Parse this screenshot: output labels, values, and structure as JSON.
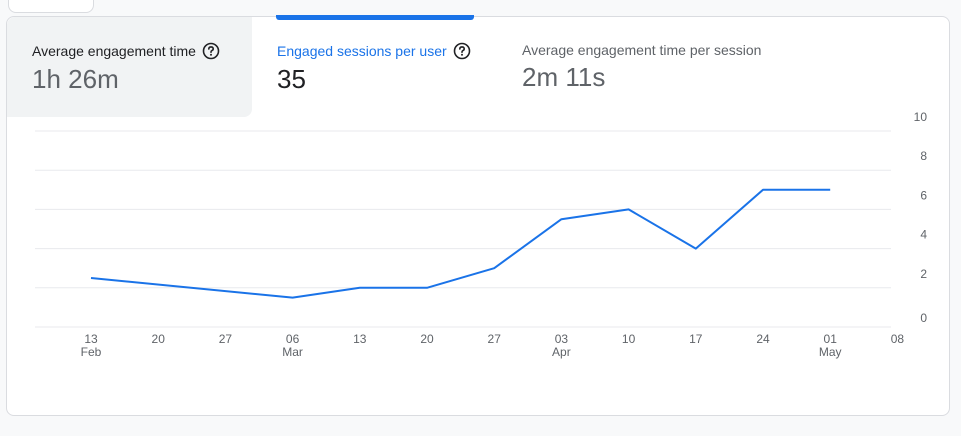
{
  "metrics": [
    {
      "label": "Average engagement time",
      "value": "1h 26m",
      "has_help": true
    },
    {
      "label": "Engaged sessions per user",
      "value": "35",
      "has_help": true,
      "selected": true
    },
    {
      "label": "Average engagement time per session",
      "value": "2m 11s",
      "has_help": false
    }
  ],
  "colors": {
    "accent": "#1a73e8",
    "line": "#1a73e8",
    "grid": "#e8eaed",
    "text": "#202124",
    "muted": "#5f6368"
  },
  "chart_data": {
    "type": "line",
    "x_ticks": [
      {
        "label": "13",
        "sub": "Feb"
      },
      {
        "label": "20",
        "sub": ""
      },
      {
        "label": "27",
        "sub": ""
      },
      {
        "label": "06",
        "sub": "Mar"
      },
      {
        "label": "13",
        "sub": ""
      },
      {
        "label": "20",
        "sub": ""
      },
      {
        "label": "27",
        "sub": ""
      },
      {
        "label": "03",
        "sub": "Apr"
      },
      {
        "label": "10",
        "sub": ""
      },
      {
        "label": "17",
        "sub": ""
      },
      {
        "label": "24",
        "sub": ""
      },
      {
        "label": "01",
        "sub": "May"
      },
      {
        "label": "08",
        "sub": ""
      }
    ],
    "series": [
      {
        "values": [
          2.5,
          null,
          null,
          1.5,
          2.0,
          2.0,
          3.0,
          5.5,
          6.0,
          4.0,
          7.0,
          7.0
        ]
      }
    ],
    "y_ticks": [
      "0",
      "2",
      "4",
      "6",
      "8",
      "10"
    ],
    "ylim": [
      0,
      10
    ],
    "grid": true,
    "y_axis_side": "right"
  }
}
